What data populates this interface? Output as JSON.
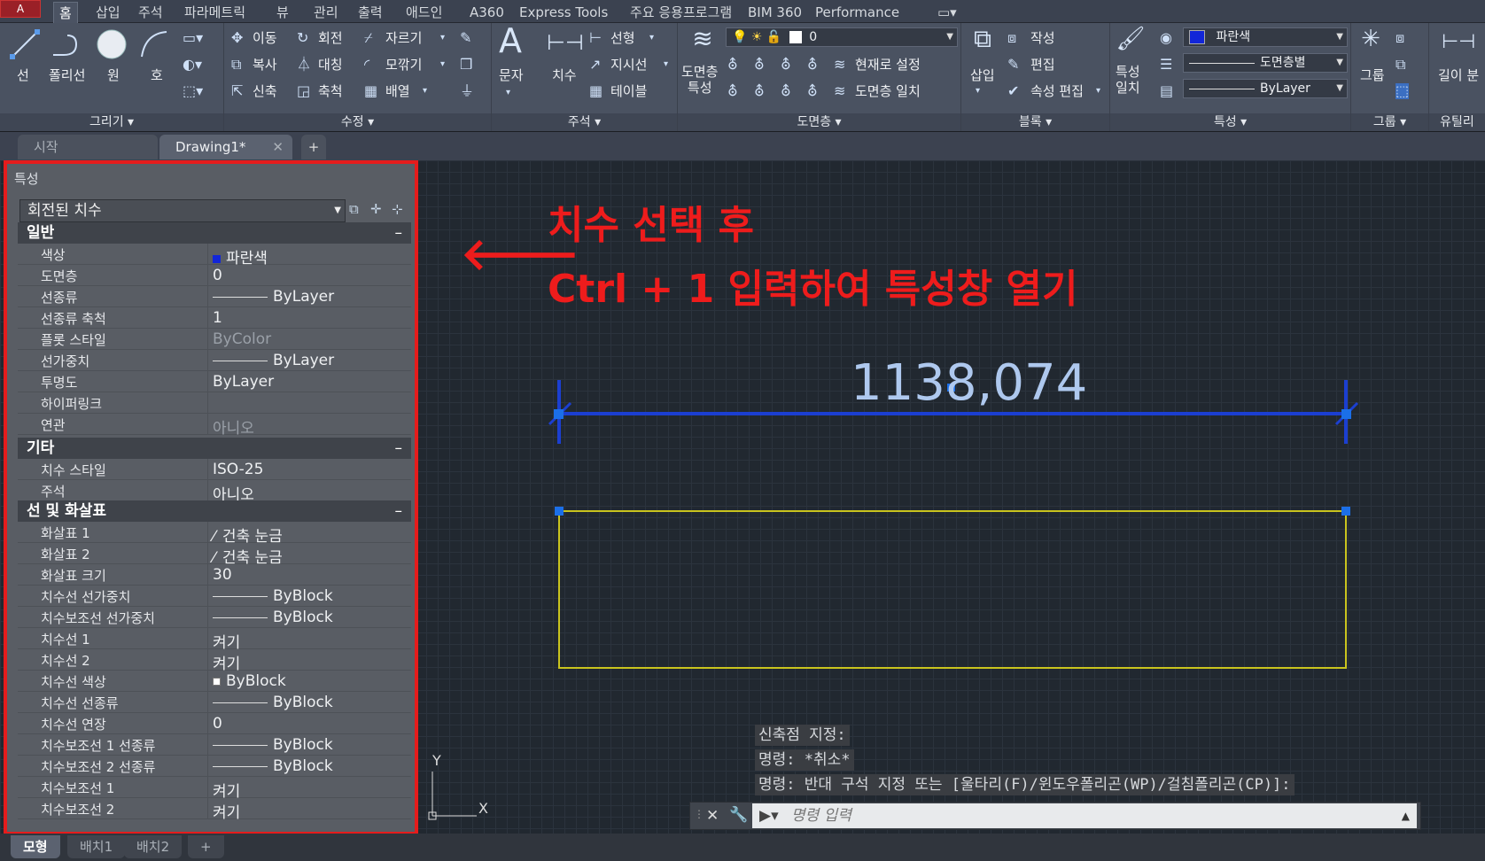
{
  "app_button": "A",
  "ribbon_tabs": [
    "홈",
    "삽입",
    "주석",
    "파라메트릭",
    "뷰",
    "관리",
    "출력",
    "애드인",
    "A360",
    "Express Tools",
    "주요 응용프로그램",
    "BIM 360",
    "Performance"
  ],
  "draw": {
    "title": "그리기 ▾",
    "line": "선",
    "polyline": "폴리선",
    "circle": "원",
    "arc": "호"
  },
  "modify": {
    "title": "수정 ▾",
    "move": "이동",
    "rotate": "회전",
    "trim": "자르기",
    "copy": "복사",
    "mirror": "대칭",
    "fillet": "모깎기",
    "stretch": "신축",
    "scale": "축척",
    "array": "배열"
  },
  "annotation": {
    "title": "주석 ▾",
    "text": "문자",
    "dimension": "치수",
    "linear": "선형",
    "leader": "지시선",
    "table": "테이블"
  },
  "layers": {
    "title": "도면층 ▾",
    "layer_props": "도면층\n특성",
    "current_layer": "0",
    "make_current": "현재로 설정",
    "match_layer": "도면층 일치"
  },
  "block": {
    "title": "블록 ▾",
    "insert": "삽입",
    "create": "작성",
    "edit": "편집",
    "edit_attr": "속성 편집"
  },
  "properties": {
    "title": "특성 ▾",
    "match": "특성\n일치",
    "color": "파란색",
    "linetype": "도면층별",
    "lineweight": "ByLayer"
  },
  "groups": {
    "title": "그룹 ▾",
    "group": "그룹"
  },
  "utilities": {
    "title": "유틸리",
    "measure": "길이 분"
  },
  "doc_tabs": {
    "start": "시작",
    "drawing": "Drawing1*",
    "add": "+"
  },
  "props_panel": {
    "title": "특성",
    "object_type": "회전된 치수",
    "sections": [
      {
        "title": "일반",
        "rows": [
          {
            "name": "색상",
            "value": "파란색"
          },
          {
            "name": "도면층",
            "value": "0"
          },
          {
            "name": "선종류",
            "value": "ByLayer"
          },
          {
            "name": "선종류 축척",
            "value": "1"
          },
          {
            "name": "플롯 스타일",
            "value": "ByColor"
          },
          {
            "name": "선가중치",
            "value": "ByLayer"
          },
          {
            "name": "투명도",
            "value": "ByLayer"
          },
          {
            "name": "하이퍼링크",
            "value": ""
          },
          {
            "name": "연관",
            "value": "아니오"
          }
        ]
      },
      {
        "title": "기타",
        "rows": [
          {
            "name": "치수 스타일",
            "value": "ISO-25"
          },
          {
            "name": "주석",
            "value": "아니오"
          }
        ]
      },
      {
        "title": "선 및 화살표",
        "rows": [
          {
            "name": "화살표 1",
            "value": "건축 눈금"
          },
          {
            "name": "화살표 2",
            "value": "건축 눈금"
          },
          {
            "name": "화살표 크기",
            "value": "30"
          },
          {
            "name": "치수선 선가중치",
            "value": "ByBlock"
          },
          {
            "name": "치수보조선 선가중치",
            "value": "ByBlock"
          },
          {
            "name": "치수선 1",
            "value": "켜기"
          },
          {
            "name": "치수선 2",
            "value": "켜기"
          },
          {
            "name": "치수선 색상",
            "value": "ByBlock"
          },
          {
            "name": "치수선 선종류",
            "value": "ByBlock"
          },
          {
            "name": "치수선 연장",
            "value": "0"
          },
          {
            "name": "치수보조선 1 선종류",
            "value": "ByBlock"
          },
          {
            "name": "치수보조선 2 선종류",
            "value": "ByBlock"
          },
          {
            "name": "치수보조선 1",
            "value": "켜기"
          },
          {
            "name": "치수보조선 2",
            "value": "켜기"
          }
        ]
      }
    ]
  },
  "annotation_text": {
    "line1": "치수 선택 후",
    "line2": "Ctrl + 1 입력하여 특성창 열기"
  },
  "dimension_value": "1138,074",
  "ucs": {
    "x": "X",
    "y": "Y"
  },
  "command_history": [
    "신축점 지정:",
    "명령: *취소*",
    "명령: 반대 구석 지정 또는 [울타리(F)/윈도우폴리곤(WP)/걸침폴리곤(CP)]:"
  ],
  "command_placeholder": "명령 입력",
  "layout_tabs": [
    "모형",
    "배치1",
    "배치2",
    "+"
  ],
  "colors": {
    "accent_red": "#e51c1c",
    "dim_blue": "#1b3fd1",
    "rect_yellow": "#c9c41e",
    "grip_blue": "#1b6fe8",
    "swatch_blue": "#1226d8"
  }
}
